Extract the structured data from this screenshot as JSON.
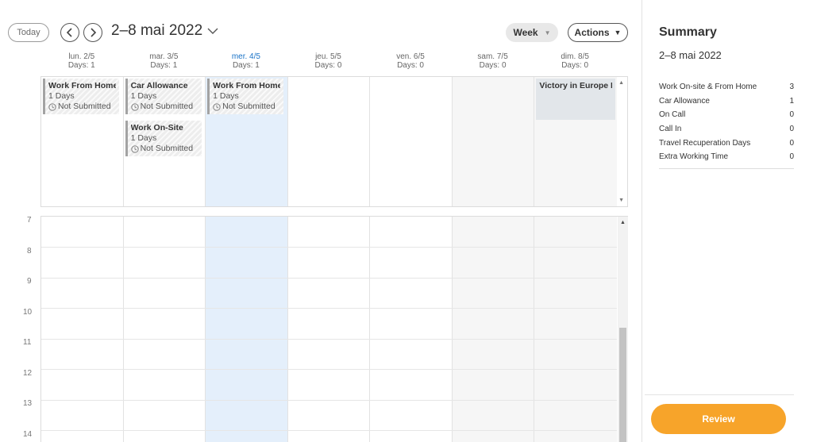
{
  "toolbar": {
    "today_label": "Today",
    "range_title": "2–8 mai 2022",
    "week_label": "Week",
    "actions_label": "Actions"
  },
  "days": [
    {
      "label": "lun. 2/5",
      "count": "Days: 1"
    },
    {
      "label": "mar. 3/5",
      "count": "Days: 1"
    },
    {
      "label": "mer. 4/5",
      "count": "Days: 1"
    },
    {
      "label": "jeu. 5/5",
      "count": "Days: 0"
    },
    {
      "label": "ven. 6/5",
      "count": "Days: 0"
    },
    {
      "label": "sam. 7/5",
      "count": "Days: 0"
    },
    {
      "label": "dim. 8/5",
      "count": "Days: 0"
    }
  ],
  "events": [
    {
      "title": "Work From Home",
      "duration": "1 Days",
      "status": "Not Submitted"
    },
    {
      "title": "Car Allowance",
      "duration": "1 Days",
      "status": "Not Submitted"
    },
    {
      "title": "Work On-Site",
      "duration": "1 Days",
      "status": "Not Submitted"
    },
    {
      "title": "Work From Home",
      "duration": "1 Days",
      "status": "Not Submitted"
    },
    {
      "title": "Victory in Europe Day"
    }
  ],
  "hours": [
    "7",
    "8",
    "9",
    "10",
    "11",
    "12",
    "13",
    "14"
  ],
  "summary": {
    "title": "Summary",
    "range": "2–8 mai 2022",
    "rows": [
      {
        "label": "Work On-site & From Home",
        "value": "3"
      },
      {
        "label": "Car Allowance",
        "value": "1"
      },
      {
        "label": "On Call",
        "value": "0"
      },
      {
        "label": "Call In",
        "value": "0"
      },
      {
        "label": "Travel Recuperation Days",
        "value": "0"
      },
      {
        "label": "Extra Working Time",
        "value": "0"
      }
    ],
    "review_label": "Review"
  },
  "colors": {
    "today_column": "#e4effb",
    "today_header": "#1a73c7",
    "weekend_column": "#f6f6f6",
    "review_button": "#f7a42a"
  }
}
